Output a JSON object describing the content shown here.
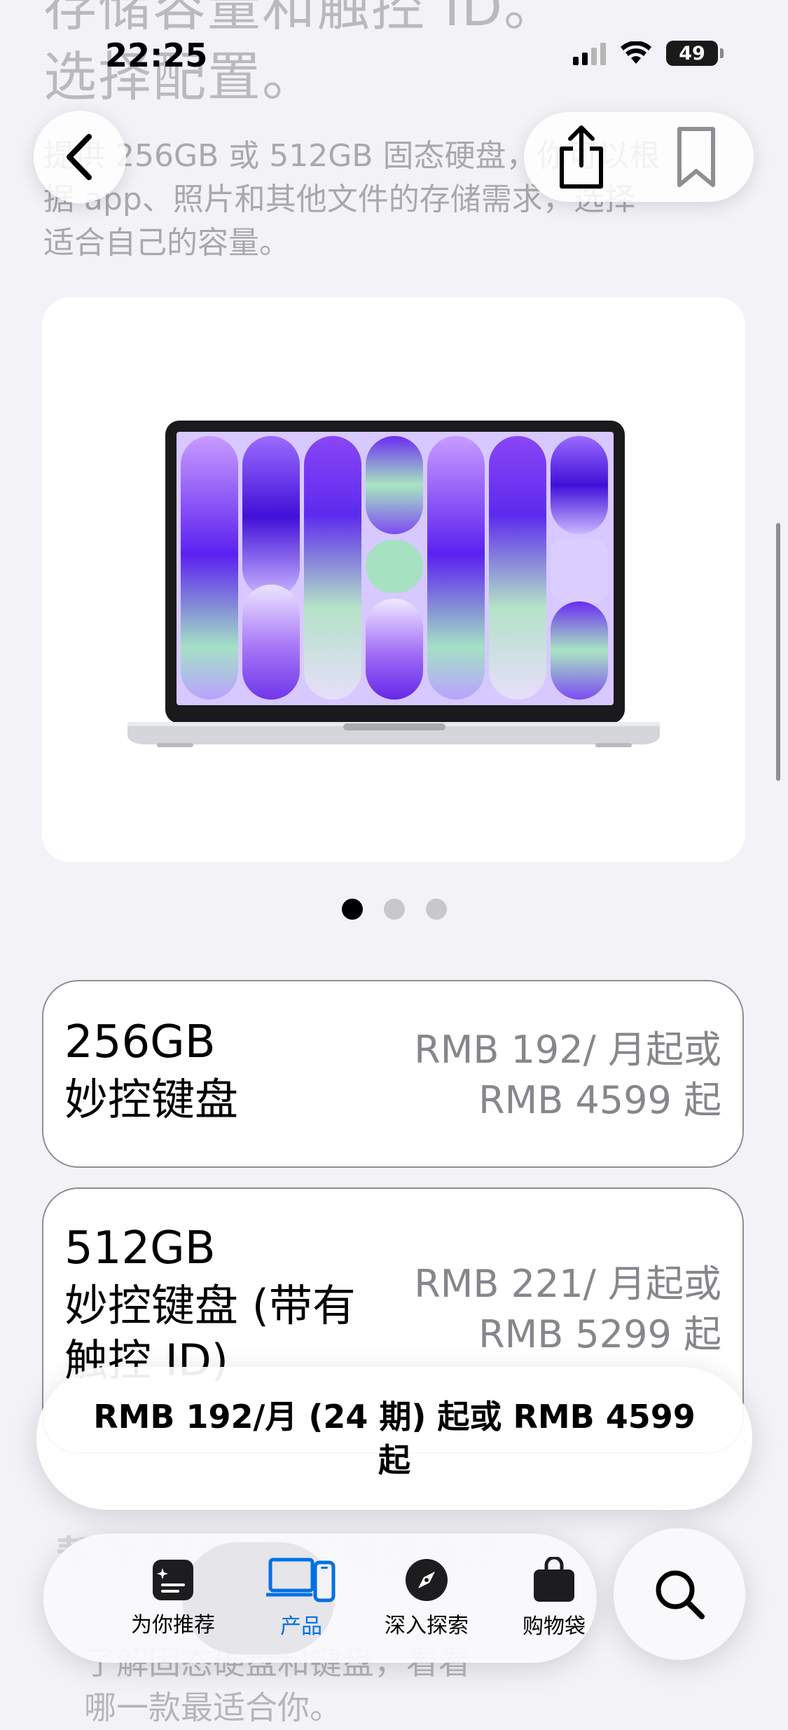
{
  "status_bar": {
    "time": "22:25",
    "battery": "49"
  },
  "intro": {
    "heading_line1": "存储容量和触控 ID。",
    "heading_line2": "选择配置。",
    "body_lines": [
      "提供 256GB 或 512GB 固态硬盘，你可以根",
      "据 app、照片和其他文件的存储需求，选择",
      "适合自己的容量。"
    ]
  },
  "nav": {
    "back_label": "返回",
    "share_label": "分享",
    "bookmark_label": "书签"
  },
  "carousel": {
    "slide_count": 3,
    "active_index": 0
  },
  "options": [
    {
      "size": "256GB",
      "desc_line1": "妙控键盘",
      "desc_line2": "",
      "price_line1": "RMB 192/ 月起或",
      "price_line2": "RMB 4599 起"
    },
    {
      "size": "512GB",
      "desc_line1": "妙控键盘 (带有",
      "desc_line2": "触控 ID)",
      "price_line1": "RMB 221/ 月起或",
      "price_line2": "RMB 5299 起"
    }
  ],
  "price_bar": {
    "text": "RMB 192/月 (24 期) 起或 RMB 4599 起"
  },
  "below": {
    "heading": "帮你选择存储和键盘选项",
    "body_line1": "了解固态硬盘和键盘，看看",
    "body_line2": "哪一款最适合你。"
  },
  "tabbar": {
    "items": [
      {
        "label": "为你推荐",
        "icon": "for-you-icon"
      },
      {
        "label": "产品",
        "icon": "devices-icon"
      },
      {
        "label": "深入探索",
        "icon": "compass-icon"
      },
      {
        "label": "购物袋",
        "icon": "bag-icon"
      }
    ],
    "active_index": 1,
    "search_icon": "search-icon"
  },
  "colors": {
    "accent": "#0071e3",
    "background": "#f2f2f7",
    "price_gray": "#86868b"
  }
}
